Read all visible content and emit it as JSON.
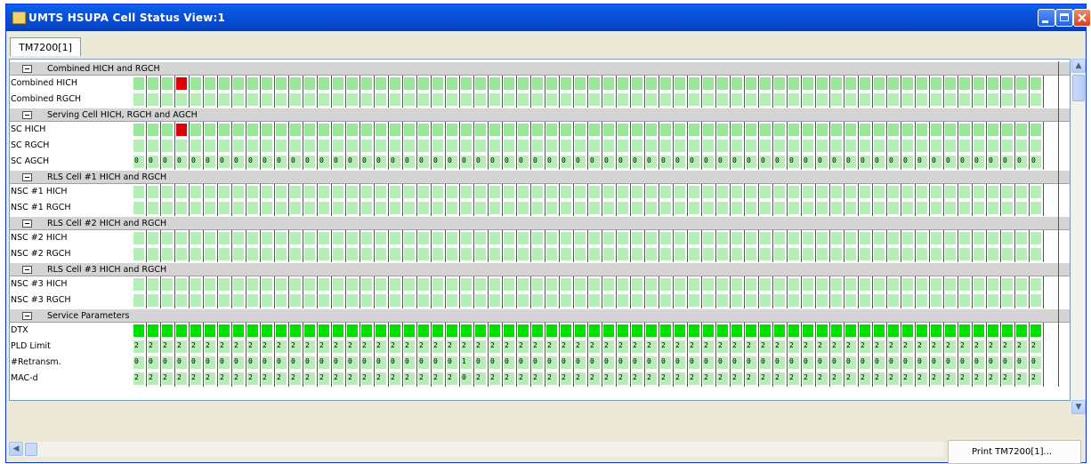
{
  "window": {
    "title": "UMTS HSUPA Cell Status View:1"
  },
  "tabs": [
    {
      "label": "TM7200[1]"
    }
  ],
  "colors": {
    "cell_green": "#99e799",
    "cell_green_light": "#b6efb6",
    "cell_bright": "#00e000",
    "cell_red": "#e00000",
    "header_bg": "#d4d4d4"
  },
  "grid": {
    "column_count": 64,
    "sections": [
      {
        "header": "Combined HICH and RGCH",
        "rows": [
          {
            "label": "Combined HICH",
            "style": "green"
          },
          {
            "label": "Combined RGCH",
            "style": "light"
          }
        ]
      },
      {
        "header": "Serving Cell HICH, RGCH and AGCH",
        "rows": [
          {
            "label": "SC HICH",
            "style": "green"
          },
          {
            "label": "SC RGCH",
            "style": "light"
          },
          {
            "label": "SC AGCH",
            "style": "text",
            "value": "0"
          }
        ]
      },
      {
        "header": "RLS Cell #1 HICH and RGCH",
        "rows": [
          {
            "label": "NSC #1 HICH",
            "style": "light"
          },
          {
            "label": "NSC #1 RGCH",
            "style": "light"
          }
        ]
      },
      {
        "header": "RLS Cell #2 HICH and RGCH",
        "rows": [
          {
            "label": "NSC #2 HICH",
            "style": "light"
          },
          {
            "label": "NSC #2 RGCH",
            "style": "light"
          }
        ]
      },
      {
        "header": "RLS Cell #3 HICH and RGCH",
        "rows": [
          {
            "label": "NSC #3 HICH",
            "style": "light"
          },
          {
            "label": "NSC #3 RGCH",
            "style": "light"
          }
        ]
      },
      {
        "header": "Service Parameters",
        "rows": [
          {
            "label": "DTX",
            "style": "bright"
          },
          {
            "label": "PLD Limit",
            "style": "text",
            "value": "2"
          },
          {
            "label": "#Retransm.",
            "style": "text",
            "value": "0",
            "exceptions": {
              "23": "1"
            }
          },
          {
            "label": "MAC-d",
            "style": "text",
            "value": "2",
            "exceptions": {
              "23": "0"
            }
          }
        ]
      }
    ],
    "red_cells": [
      {
        "row": "Combined HICH",
        "col": 3
      },
      {
        "row": "SC HICH",
        "col": 3
      }
    ]
  },
  "context_menu": {
    "print_label": "Print TM7200[1]..."
  }
}
